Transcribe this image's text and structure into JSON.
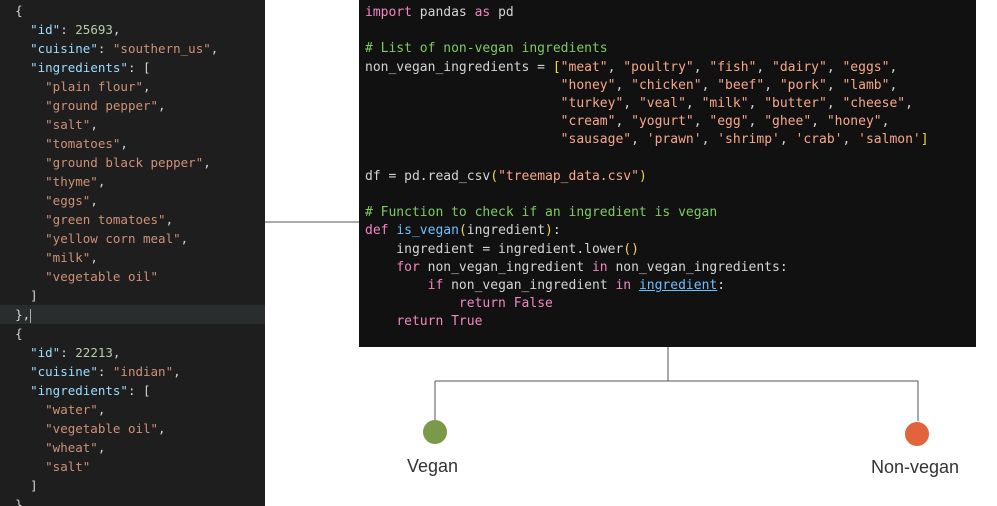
{
  "json_lines": [
    {
      "indent": "  ",
      "segments": [
        {
          "t": "p",
          "v": "{"
        }
      ]
    },
    {
      "indent": "    ",
      "segments": [
        {
          "t": "k",
          "v": "\"id\""
        },
        {
          "t": "p",
          "v": ": "
        },
        {
          "t": "n",
          "v": "25693"
        },
        {
          "t": "p",
          "v": ","
        }
      ]
    },
    {
      "indent": "    ",
      "segments": [
        {
          "t": "k",
          "v": "\"cuisine\""
        },
        {
          "t": "p",
          "v": ": "
        },
        {
          "t": "s",
          "v": "\"southern_us\""
        },
        {
          "t": "p",
          "v": ","
        }
      ]
    },
    {
      "indent": "    ",
      "segments": [
        {
          "t": "k",
          "v": "\"ingredients\""
        },
        {
          "t": "p",
          "v": ": ["
        }
      ]
    },
    {
      "indent": "      ",
      "segments": [
        {
          "t": "s",
          "v": "\"plain flour\""
        },
        {
          "t": "p",
          "v": ","
        }
      ]
    },
    {
      "indent": "      ",
      "segments": [
        {
          "t": "s",
          "v": "\"ground pepper\""
        },
        {
          "t": "p",
          "v": ","
        }
      ]
    },
    {
      "indent": "      ",
      "segments": [
        {
          "t": "s",
          "v": "\"salt\""
        },
        {
          "t": "p",
          "v": ","
        }
      ]
    },
    {
      "indent": "      ",
      "segments": [
        {
          "t": "s",
          "v": "\"tomatoes\""
        },
        {
          "t": "p",
          "v": ","
        }
      ]
    },
    {
      "indent": "      ",
      "segments": [
        {
          "t": "s",
          "v": "\"ground black pepper\""
        },
        {
          "t": "p",
          "v": ","
        }
      ]
    },
    {
      "indent": "      ",
      "segments": [
        {
          "t": "s",
          "v": "\"thyme\""
        },
        {
          "t": "p",
          "v": ","
        }
      ]
    },
    {
      "indent": "      ",
      "segments": [
        {
          "t": "s",
          "v": "\"eggs\""
        },
        {
          "t": "p",
          "v": ","
        }
      ]
    },
    {
      "indent": "      ",
      "segments": [
        {
          "t": "s",
          "v": "\"green tomatoes\""
        },
        {
          "t": "p",
          "v": ","
        }
      ]
    },
    {
      "indent": "      ",
      "segments": [
        {
          "t": "s",
          "v": "\"yellow corn meal\""
        },
        {
          "t": "p",
          "v": ","
        }
      ]
    },
    {
      "indent": "      ",
      "segments": [
        {
          "t": "s",
          "v": "\"milk\""
        },
        {
          "t": "p",
          "v": ","
        }
      ]
    },
    {
      "indent": "      ",
      "segments": [
        {
          "t": "s",
          "v": "\"vegetable oil\""
        }
      ]
    },
    {
      "indent": "    ",
      "segments": [
        {
          "t": "p",
          "v": "]"
        }
      ]
    },
    {
      "indent": "  ",
      "highlight": true,
      "caret": true,
      "segments": [
        {
          "t": "p",
          "v": "},"
        }
      ]
    },
    {
      "indent": "  ",
      "segments": [
        {
          "t": "p",
          "v": "{"
        }
      ]
    },
    {
      "indent": "    ",
      "segments": [
        {
          "t": "k",
          "v": "\"id\""
        },
        {
          "t": "p",
          "v": ": "
        },
        {
          "t": "n",
          "v": "22213"
        },
        {
          "t": "p",
          "v": ","
        }
      ]
    },
    {
      "indent": "    ",
      "segments": [
        {
          "t": "k",
          "v": "\"cuisine\""
        },
        {
          "t": "p",
          "v": ": "
        },
        {
          "t": "s",
          "v": "\"indian\""
        },
        {
          "t": "p",
          "v": ","
        }
      ]
    },
    {
      "indent": "    ",
      "segments": [
        {
          "t": "k",
          "v": "\"ingredients\""
        },
        {
          "t": "p",
          "v": ": ["
        }
      ]
    },
    {
      "indent": "      ",
      "segments": [
        {
          "t": "s",
          "v": "\"water\""
        },
        {
          "t": "p",
          "v": ","
        }
      ]
    },
    {
      "indent": "      ",
      "segments": [
        {
          "t": "s",
          "v": "\"vegetable oil\""
        },
        {
          "t": "p",
          "v": ","
        }
      ]
    },
    {
      "indent": "      ",
      "segments": [
        {
          "t": "s",
          "v": "\"wheat\""
        },
        {
          "t": "p",
          "v": ","
        }
      ]
    },
    {
      "indent": "      ",
      "segments": [
        {
          "t": "s",
          "v": "\"salt\""
        }
      ]
    },
    {
      "indent": "    ",
      "segments": [
        {
          "t": "p",
          "v": "]"
        }
      ]
    },
    {
      "indent": "  ",
      "segments": [
        {
          "t": "p",
          "v": "},"
        }
      ]
    }
  ],
  "code_lines": [
    {
      "segments": [
        {
          "t": "kw",
          "v": "import"
        },
        {
          "t": "p",
          "v": " pandas "
        },
        {
          "t": "kw",
          "v": "as"
        },
        {
          "t": "p",
          "v": " pd"
        }
      ]
    },
    {
      "segments": []
    },
    {
      "segments": [
        {
          "t": "cm",
          "v": "# List of non-vegan ingredients"
        }
      ]
    },
    {
      "segments": [
        {
          "t": "p",
          "v": "non_vegan_ingredients = "
        },
        {
          "t": "par",
          "v": "["
        },
        {
          "t": "str",
          "v": "\"meat\""
        },
        {
          "t": "p",
          "v": ", "
        },
        {
          "t": "str",
          "v": "\"poultry\""
        },
        {
          "t": "p",
          "v": ", "
        },
        {
          "t": "str",
          "v": "\"fish\""
        },
        {
          "t": "p",
          "v": ", "
        },
        {
          "t": "str",
          "v": "\"dairy\""
        },
        {
          "t": "p",
          "v": ", "
        },
        {
          "t": "str",
          "v": "\"eggs\""
        },
        {
          "t": "p",
          "v": ","
        }
      ]
    },
    {
      "segments": [
        {
          "t": "p",
          "v": "                         "
        },
        {
          "t": "str",
          "v": "\"honey\""
        },
        {
          "t": "p",
          "v": ", "
        },
        {
          "t": "str",
          "v": "\"chicken\""
        },
        {
          "t": "p",
          "v": ", "
        },
        {
          "t": "str",
          "v": "\"beef\""
        },
        {
          "t": "p",
          "v": ", "
        },
        {
          "t": "str",
          "v": "\"pork\""
        },
        {
          "t": "p",
          "v": ", "
        },
        {
          "t": "str",
          "v": "\"lamb\""
        },
        {
          "t": "p",
          "v": ","
        }
      ]
    },
    {
      "segments": [
        {
          "t": "p",
          "v": "                         "
        },
        {
          "t": "str",
          "v": "\"turkey\""
        },
        {
          "t": "p",
          "v": ", "
        },
        {
          "t": "str",
          "v": "\"veal\""
        },
        {
          "t": "p",
          "v": ", "
        },
        {
          "t": "str",
          "v": "\"milk\""
        },
        {
          "t": "p",
          "v": ", "
        },
        {
          "t": "str",
          "v": "\"butter\""
        },
        {
          "t": "p",
          "v": ", "
        },
        {
          "t": "str",
          "v": "\"cheese\""
        },
        {
          "t": "p",
          "v": ","
        }
      ]
    },
    {
      "segments": [
        {
          "t": "p",
          "v": "                         "
        },
        {
          "t": "str",
          "v": "\"cream\""
        },
        {
          "t": "p",
          "v": ", "
        },
        {
          "t": "str",
          "v": "\"yogurt\""
        },
        {
          "t": "p",
          "v": ", "
        },
        {
          "t": "str",
          "v": "\"egg\""
        },
        {
          "t": "p",
          "v": ", "
        },
        {
          "t": "str",
          "v": "\"ghee\""
        },
        {
          "t": "p",
          "v": ", "
        },
        {
          "t": "str",
          "v": "\"honey\""
        },
        {
          "t": "p",
          "v": ","
        }
      ]
    },
    {
      "segments": [
        {
          "t": "p",
          "v": "                         "
        },
        {
          "t": "str",
          "v": "\"sausage\""
        },
        {
          "t": "p",
          "v": ", "
        },
        {
          "t": "str",
          "v": "'prawn'"
        },
        {
          "t": "p",
          "v": ", "
        },
        {
          "t": "str",
          "v": "'shrimp'"
        },
        {
          "t": "p",
          "v": ", "
        },
        {
          "t": "str",
          "v": "'crab'"
        },
        {
          "t": "p",
          "v": ", "
        },
        {
          "t": "str",
          "v": "'salmon'"
        },
        {
          "t": "par",
          "v": "]"
        }
      ]
    },
    {
      "segments": []
    },
    {
      "segments": [
        {
          "t": "p",
          "v": "df = pd.read_csv"
        },
        {
          "t": "par",
          "v": "("
        },
        {
          "t": "str",
          "v": "\"treemap_data.csv\""
        },
        {
          "t": "par",
          "v": ")"
        }
      ]
    },
    {
      "segments": []
    },
    {
      "segments": [
        {
          "t": "cm",
          "v": "# Function to check if an ingredient is vegan"
        }
      ]
    },
    {
      "segments": [
        {
          "t": "kw",
          "v": "def"
        },
        {
          "t": "p",
          "v": " "
        },
        {
          "t": "fn",
          "v": "is_vegan"
        },
        {
          "t": "par",
          "v": "("
        },
        {
          "t": "p",
          "v": "ingredient"
        },
        {
          "t": "par",
          "v": ")"
        },
        {
          "t": "p",
          "v": ":"
        }
      ]
    },
    {
      "segments": [
        {
          "t": "p",
          "v": "    ingredient = ingredient.lower"
        },
        {
          "t": "par",
          "v": "()"
        }
      ]
    },
    {
      "segments": [
        {
          "t": "p",
          "v": "    "
        },
        {
          "t": "kw",
          "v": "for"
        },
        {
          "t": "p",
          "v": " non_vegan_ingredient "
        },
        {
          "t": "kw",
          "v": "in"
        },
        {
          "t": "p",
          "v": " non_vegan_ingredients:"
        }
      ]
    },
    {
      "segments": [
        {
          "t": "p",
          "v": "        "
        },
        {
          "t": "kw",
          "v": "if"
        },
        {
          "t": "p",
          "v": " non_vegan_ingredient "
        },
        {
          "t": "kw",
          "v": "in"
        },
        {
          "t": "p",
          "v": " "
        },
        {
          "t": "ul",
          "v": "ingredient"
        },
        {
          "t": "p",
          "v": ":"
        }
      ]
    },
    {
      "segments": [
        {
          "t": "p",
          "v": "            "
        },
        {
          "t": "kw",
          "v": "return"
        },
        {
          "t": "p",
          "v": " "
        },
        {
          "t": "kw",
          "v": "False"
        }
      ]
    },
    {
      "segments": [
        {
          "t": "p",
          "v": "    "
        },
        {
          "t": "kw",
          "v": "return"
        },
        {
          "t": "p",
          "v": " "
        },
        {
          "t": "kw",
          "v": "True"
        }
      ]
    }
  ],
  "leaves": {
    "vegan": {
      "label": "Vegan",
      "color": "#7a9a4a"
    },
    "nonvegan": {
      "label": "Non-vegan",
      "color": "#e2643c"
    }
  }
}
